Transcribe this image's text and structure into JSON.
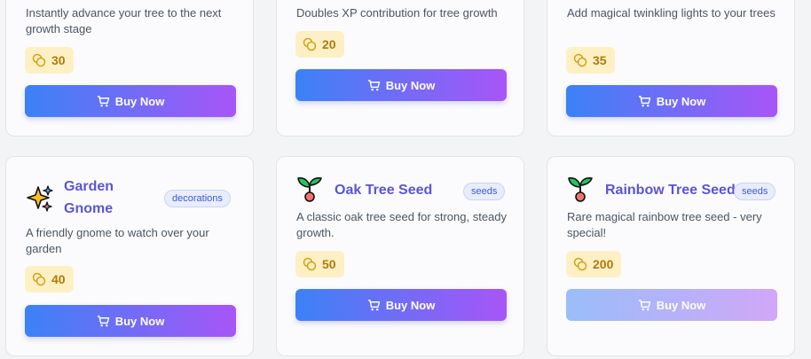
{
  "shop": {
    "buy_label": "Buy Now",
    "items": [
      {
        "description": "Instantly advance your tree to the next growth stage",
        "price": "30"
      },
      {
        "description": "Doubles XP contribution for tree growth",
        "price": "20"
      },
      {
        "description": "Add magical twinkling lights to your trees",
        "price": "35"
      },
      {
        "name": "Garden Gnome",
        "category": "decorations",
        "description": "A friendly gnome to watch over your garden",
        "price": "40",
        "icon": "sparkles-icon"
      },
      {
        "name": "Oak Tree Seed",
        "category": "seeds",
        "description": "A classic oak tree seed for strong, steady growth.",
        "price": "50",
        "icon": "sprout-icon"
      },
      {
        "name": "Rainbow Tree Seed",
        "category": "seeds",
        "description": "Rare magical rainbow tree seed - very special!",
        "price": "200",
        "icon": "sprout-icon",
        "buy_disabled": true
      }
    ]
  },
  "colors": {
    "title": "#5b55d6",
    "price_bg": "#fdf0c4",
    "price_text": "#b07a0e",
    "button_gradient_start": "#3b82f6",
    "button_gradient_end": "#a855f7"
  }
}
